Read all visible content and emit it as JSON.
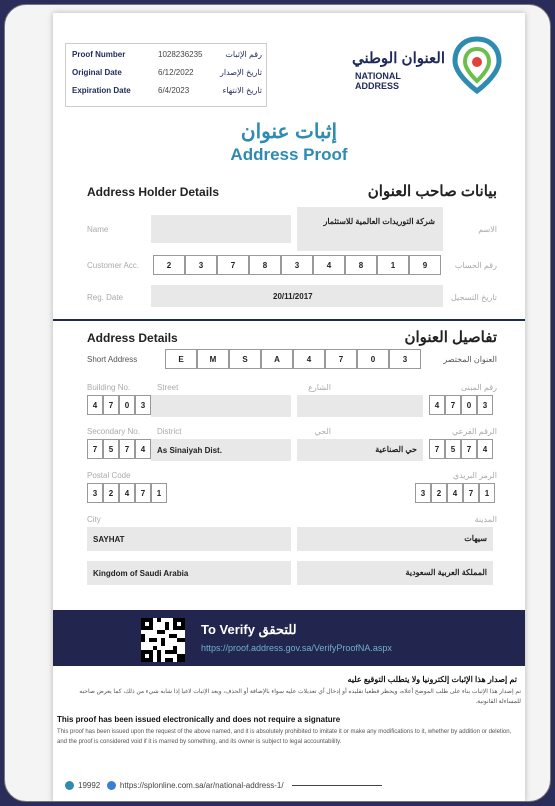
{
  "header": {
    "proof_number_label_en": "Proof Number",
    "proof_number_value": "1028236235",
    "proof_number_label_ar": "رقم الإثبات",
    "original_date_label_en": "Original Date",
    "original_date_value": "6/12/2022",
    "original_date_label_ar": "تاريخ الإصدار",
    "expiration_date_label_en": "Expiration Date",
    "expiration_date_value": "6/4/2023",
    "expiration_date_label_ar": "تاريخ الانتهاء",
    "logo_ar": "العنوان الوطني",
    "logo_en": "NATIONAL ADDRESS"
  },
  "title": {
    "ar": "إثبات عنوان",
    "en": "Address Proof"
  },
  "holder": {
    "section_en": "Address Holder Details",
    "section_ar": "بيانات صاحب العنوان",
    "name_label_en": "Name",
    "name_label_ar": "الاسم",
    "name_value_ar": "شركة التوريدات العالمية للاستثمار",
    "customer_acc_label_en": "Customer Acc.",
    "customer_acc_label_ar": "رقم الحساب",
    "customer_acc_digits": [
      "2",
      "3",
      "7",
      "8",
      "3",
      "4",
      "8",
      "1",
      "9"
    ],
    "reg_date_label_en": "Reg. Date",
    "reg_date_label_ar": "تاريخ التسجيل",
    "reg_date_value": "20/11/2017"
  },
  "address": {
    "section_en": "Address Details",
    "section_ar": "تفاصيل العنوان",
    "short_label_en": "Short Address",
    "short_label_ar": "العنوان المختصر",
    "short_chars": [
      "E",
      "M",
      "S",
      "A",
      "4",
      "7",
      "0",
      "3"
    ],
    "building_label_en": "Building No.",
    "building_label_ar": "رقم المبنى",
    "building_digits": [
      "4",
      "7",
      "0",
      "3"
    ],
    "street_label_en": "Street",
    "street_label_ar": "الشارع",
    "secondary_label_en": "Secondary No.",
    "secondary_label_ar": "الرقم الفرعي",
    "secondary_digits": [
      "7",
      "5",
      "7",
      "4"
    ],
    "district_label_en": "District",
    "district_label_ar": "الحي",
    "district_en": "As Sinaiyah Dist.",
    "district_ar": "حي الصناعية",
    "postal_label_en": "Postal Code",
    "postal_label_ar": "الرمز البريدي",
    "postal_digits": [
      "3",
      "2",
      "4",
      "7",
      "1"
    ],
    "city_label_en": "City",
    "city_label_ar": "المدينة",
    "city_en": "SAYHAT",
    "city_ar": "سيهات",
    "country_en": "Kingdom of Saudi Arabia",
    "country_ar": "المملكة العربية السعودية"
  },
  "verify": {
    "title": "To Verify للتحقق",
    "url": "https://proof.address.gov.sa/VerifyProofNA.aspx"
  },
  "notice": {
    "heading_ar": "تم إصدار هذا الإثبات إلكترونيا ولا يتطلب التوقيع عليه",
    "body_ar": "تم إصدار هذا الإثبات بناء على طلب الموضح أعلاه، ويحظر قطعيا تقليده أو إدخال أي تعديلات عليه سواء بالإضافة أو الحذف، ويعد الإثبات لاغيا إذا شابه شيء من ذلك، كما يعرض صاحبه للمساءلة القانونية.",
    "heading_en": "This proof has been issued electronically and does not require a signature",
    "body_en": "This proof has been issued upon the request of the above named, and it is absolutely prohibited to imitate it or make any modifications to it, whether by addition or deletion, and the proof is considered void if it is marred by something, and its owner is subject to legal accountability."
  },
  "footer": {
    "phone": "19992",
    "link": "https://splonline.com.sa/ar/national-address-1/"
  },
  "colors": {
    "navy": "#22264f",
    "accent": "#2e8bb2"
  }
}
